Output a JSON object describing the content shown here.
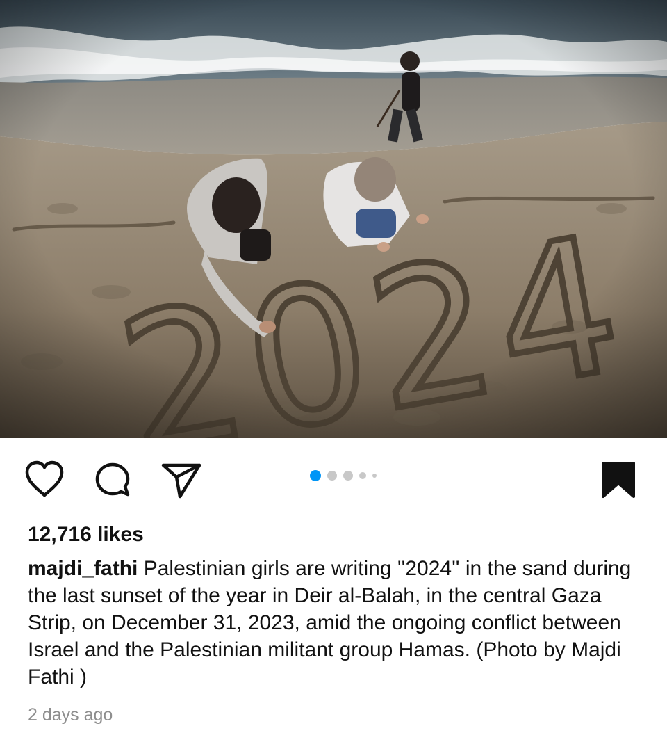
{
  "post": {
    "image_alt": "Two girls writing 2024 in the sand on a beach at sunset while a small boy walks by the waves",
    "sand_text": "2024",
    "likes_text": "12,716 likes",
    "username": "majdi_fathi",
    "caption": "Palestinian girls are writing ''2024'' in the sand during the last sunset of the year in Deir al-Balah, in the central Gaza Strip, on December 31, 2023, amid the ongoing conflict between Israel and the Palestinian militant group Hamas. (Photo by Majdi Fathi )",
    "timestamp": "2 days ago"
  },
  "actions": {
    "like_icon": "heart-outline-icon",
    "comment_icon": "speech-bubble-icon",
    "share_icon": "paper-plane-icon",
    "save_icon": "bookmark-filled-icon"
  },
  "carousel": {
    "total": 5,
    "active_index": 0,
    "active_color": "#0095f6",
    "inactive_color": "#c8c8c8"
  },
  "colors": {
    "text": "#111111",
    "muted": "#8e8e8e",
    "background": "#ffffff"
  }
}
